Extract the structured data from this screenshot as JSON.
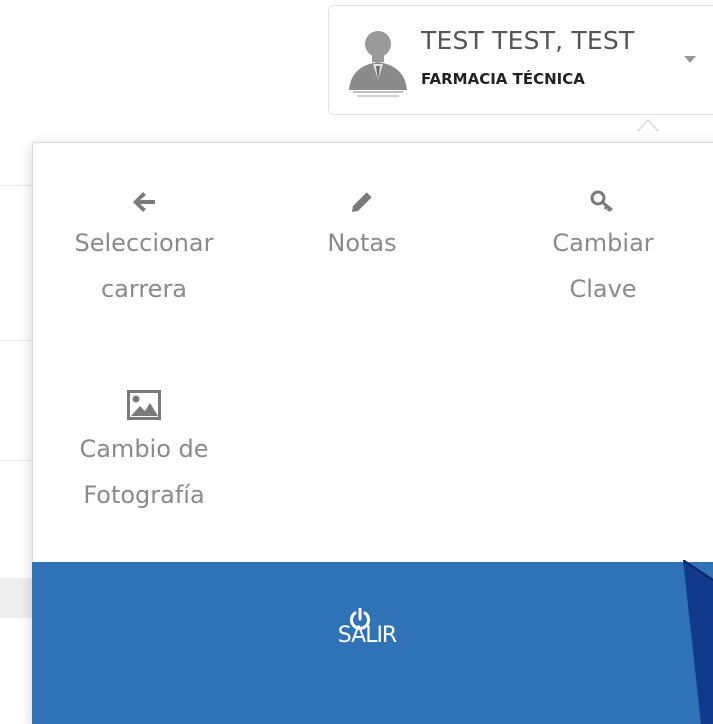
{
  "user": {
    "name": "TEST TEST, TEST",
    "career": "FARMACIA TÉCNICA",
    "avatar_icon": "user-photo-avatar",
    "dropdown_icon": "caret-down-icon"
  },
  "menu": {
    "items": [
      {
        "icon": "arrow-left-icon",
        "label_line1": "Seleccionar",
        "label_line2": "carrera"
      },
      {
        "icon": "pencil-icon",
        "label_line1": "Notas",
        "label_line2": ""
      },
      {
        "icon": "key-icon",
        "label_line1": "Cambiar",
        "label_line2": "Clave"
      },
      {
        "icon": "image-icon",
        "label_line1": "Cambio de",
        "label_line2": "Fotografía"
      }
    ],
    "logout": {
      "icon": "power-icon",
      "label": "SALIR"
    }
  },
  "colors": {
    "accent": "#2f72b6",
    "icon": "#7a7a7a",
    "text": "#8a8a8a"
  }
}
